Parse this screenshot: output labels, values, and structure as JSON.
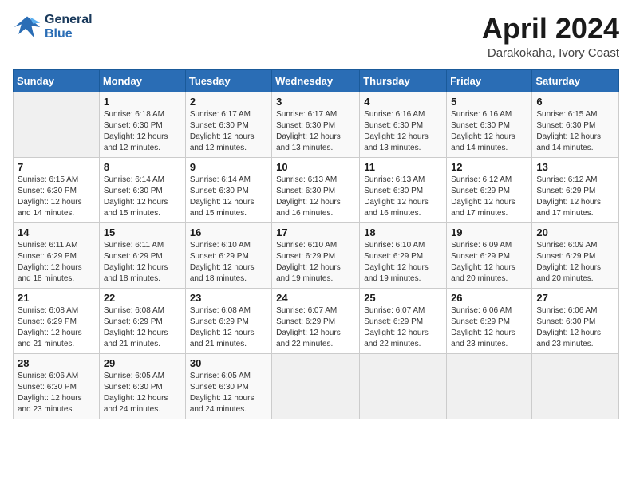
{
  "header": {
    "logo_line1": "General",
    "logo_line2": "Blue",
    "month_year": "April 2024",
    "location": "Darakokaha, Ivory Coast"
  },
  "days_of_week": [
    "Sunday",
    "Monday",
    "Tuesday",
    "Wednesday",
    "Thursday",
    "Friday",
    "Saturday"
  ],
  "weeks": [
    [
      {
        "day": "",
        "sunrise": "",
        "sunset": "",
        "daylight": ""
      },
      {
        "day": "1",
        "sunrise": "6:18 AM",
        "sunset": "6:30 PM",
        "daylight": "12 hours and 12 minutes."
      },
      {
        "day": "2",
        "sunrise": "6:17 AM",
        "sunset": "6:30 PM",
        "daylight": "12 hours and 12 minutes."
      },
      {
        "day": "3",
        "sunrise": "6:17 AM",
        "sunset": "6:30 PM",
        "daylight": "12 hours and 13 minutes."
      },
      {
        "day": "4",
        "sunrise": "6:16 AM",
        "sunset": "6:30 PM",
        "daylight": "12 hours and 13 minutes."
      },
      {
        "day": "5",
        "sunrise": "6:16 AM",
        "sunset": "6:30 PM",
        "daylight": "12 hours and 14 minutes."
      },
      {
        "day": "6",
        "sunrise": "6:15 AM",
        "sunset": "6:30 PM",
        "daylight": "12 hours and 14 minutes."
      }
    ],
    [
      {
        "day": "7",
        "sunrise": "6:15 AM",
        "sunset": "6:30 PM",
        "daylight": "12 hours and 14 minutes."
      },
      {
        "day": "8",
        "sunrise": "6:14 AM",
        "sunset": "6:30 PM",
        "daylight": "12 hours and 15 minutes."
      },
      {
        "day": "9",
        "sunrise": "6:14 AM",
        "sunset": "6:30 PM",
        "daylight": "12 hours and 15 minutes."
      },
      {
        "day": "10",
        "sunrise": "6:13 AM",
        "sunset": "6:30 PM",
        "daylight": "12 hours and 16 minutes."
      },
      {
        "day": "11",
        "sunrise": "6:13 AM",
        "sunset": "6:30 PM",
        "daylight": "12 hours and 16 minutes."
      },
      {
        "day": "12",
        "sunrise": "6:12 AM",
        "sunset": "6:29 PM",
        "daylight": "12 hours and 17 minutes."
      },
      {
        "day": "13",
        "sunrise": "6:12 AM",
        "sunset": "6:29 PM",
        "daylight": "12 hours and 17 minutes."
      }
    ],
    [
      {
        "day": "14",
        "sunrise": "6:11 AM",
        "sunset": "6:29 PM",
        "daylight": "12 hours and 18 minutes."
      },
      {
        "day": "15",
        "sunrise": "6:11 AM",
        "sunset": "6:29 PM",
        "daylight": "12 hours and 18 minutes."
      },
      {
        "day": "16",
        "sunrise": "6:10 AM",
        "sunset": "6:29 PM",
        "daylight": "12 hours and 18 minutes."
      },
      {
        "day": "17",
        "sunrise": "6:10 AM",
        "sunset": "6:29 PM",
        "daylight": "12 hours and 19 minutes."
      },
      {
        "day": "18",
        "sunrise": "6:10 AM",
        "sunset": "6:29 PM",
        "daylight": "12 hours and 19 minutes."
      },
      {
        "day": "19",
        "sunrise": "6:09 AM",
        "sunset": "6:29 PM",
        "daylight": "12 hours and 20 minutes."
      },
      {
        "day": "20",
        "sunrise": "6:09 AM",
        "sunset": "6:29 PM",
        "daylight": "12 hours and 20 minutes."
      }
    ],
    [
      {
        "day": "21",
        "sunrise": "6:08 AM",
        "sunset": "6:29 PM",
        "daylight": "12 hours and 21 minutes."
      },
      {
        "day": "22",
        "sunrise": "6:08 AM",
        "sunset": "6:29 PM",
        "daylight": "12 hours and 21 minutes."
      },
      {
        "day": "23",
        "sunrise": "6:08 AM",
        "sunset": "6:29 PM",
        "daylight": "12 hours and 21 minutes."
      },
      {
        "day": "24",
        "sunrise": "6:07 AM",
        "sunset": "6:29 PM",
        "daylight": "12 hours and 22 minutes."
      },
      {
        "day": "25",
        "sunrise": "6:07 AM",
        "sunset": "6:29 PM",
        "daylight": "12 hours and 22 minutes."
      },
      {
        "day": "26",
        "sunrise": "6:06 AM",
        "sunset": "6:29 PM",
        "daylight": "12 hours and 23 minutes."
      },
      {
        "day": "27",
        "sunrise": "6:06 AM",
        "sunset": "6:30 PM",
        "daylight": "12 hours and 23 minutes."
      }
    ],
    [
      {
        "day": "28",
        "sunrise": "6:06 AM",
        "sunset": "6:30 PM",
        "daylight": "12 hours and 23 minutes."
      },
      {
        "day": "29",
        "sunrise": "6:05 AM",
        "sunset": "6:30 PM",
        "daylight": "12 hours and 24 minutes."
      },
      {
        "day": "30",
        "sunrise": "6:05 AM",
        "sunset": "6:30 PM",
        "daylight": "12 hours and 24 minutes."
      },
      {
        "day": "",
        "sunrise": "",
        "sunset": "",
        "daylight": ""
      },
      {
        "day": "",
        "sunrise": "",
        "sunset": "",
        "daylight": ""
      },
      {
        "day": "",
        "sunrise": "",
        "sunset": "",
        "daylight": ""
      },
      {
        "day": "",
        "sunrise": "",
        "sunset": "",
        "daylight": ""
      }
    ]
  ]
}
